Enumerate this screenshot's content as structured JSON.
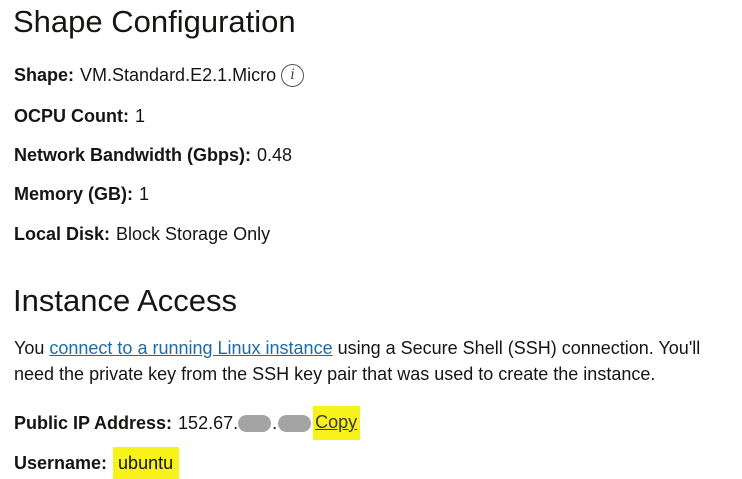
{
  "shape_section": {
    "title": "Shape Configuration",
    "shape": {
      "label": "Shape:",
      "value": "VM.Standard.E2.1.Micro",
      "icon": "info-icon"
    },
    "ocpu": {
      "label": "OCPU Count:",
      "value": "1"
    },
    "bandwidth": {
      "label": "Network Bandwidth (Gbps):",
      "value": "0.48"
    },
    "memory": {
      "label": "Memory (GB):",
      "value": "1"
    },
    "disk": {
      "label": "Local Disk:",
      "value": "Block Storage Only"
    }
  },
  "access_section": {
    "title": "Instance Access",
    "description": {
      "before": "You ",
      "link": "connect to a running Linux instance",
      "after": " using a Secure Shell (SSH) connection. You'll need the private key from the SSH key pair that was used to create the instance."
    },
    "public_ip": {
      "label": "Public IP Address:",
      "value_prefix": "152.67.",
      "separator": ".",
      "copy_label": "Copy"
    },
    "username": {
      "label": "Username:",
      "value": "ubuntu"
    }
  },
  "colors": {
    "link": "#1b6ba8",
    "highlight": "#f6f21a",
    "redaction": "#a4a4a4"
  }
}
